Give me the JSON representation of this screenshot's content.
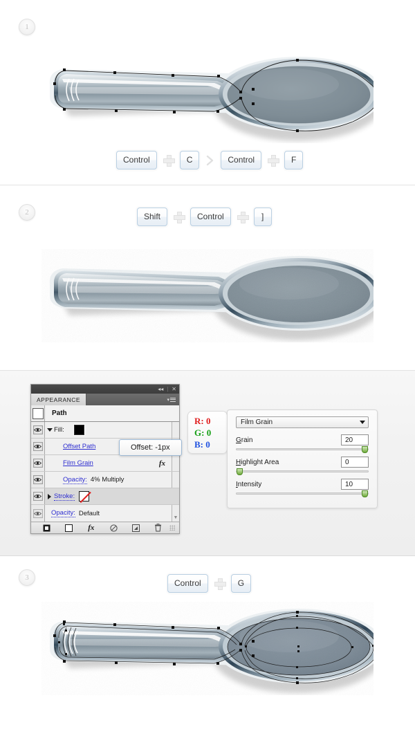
{
  "steps": [
    {
      "number": "1"
    },
    {
      "number": "2"
    },
    {
      "number": "3"
    }
  ],
  "shortcuts": [
    {
      "id": "shortcut-row-1",
      "items": [
        {
          "type": "key",
          "label": "Control"
        },
        {
          "type": "plus",
          "label": "+"
        },
        {
          "type": "key",
          "label": "C"
        },
        {
          "type": "chevron",
          "label": ">"
        },
        {
          "type": "key",
          "label": "Control"
        },
        {
          "type": "plus",
          "label": "+"
        },
        {
          "type": "key",
          "label": "F"
        }
      ]
    },
    {
      "id": "shortcut-row-2",
      "items": [
        {
          "type": "key",
          "label": "Shift"
        },
        {
          "type": "plus",
          "label": "+"
        },
        {
          "type": "key",
          "label": "Control"
        },
        {
          "type": "plus",
          "label": "+"
        },
        {
          "type": "key",
          "label": "]"
        }
      ]
    },
    {
      "id": "shortcut-row-3",
      "items": [
        {
          "type": "key",
          "label": "Control"
        },
        {
          "type": "plus",
          "label": "+"
        },
        {
          "type": "key",
          "label": "G"
        }
      ]
    }
  ],
  "appearance_panel": {
    "titlebar": {
      "collapse_icon": "◂◂",
      "separator": "|",
      "close_icon": "✕"
    },
    "tab_label": "APPEARANCE",
    "menu_icon": "panel-menu-icon",
    "object_row": {
      "label": "Path"
    },
    "rows": [
      {
        "name": "fill",
        "label": "Fill:",
        "kind": "fill",
        "swatch": "black",
        "expanded": true,
        "visible": true
      },
      {
        "name": "offset-path",
        "label": "Offset Path",
        "kind": "effect-link",
        "visible": true
      },
      {
        "name": "film-grain",
        "label": "Film Grain",
        "kind": "effect-link",
        "fx": "fx",
        "visible": true
      },
      {
        "name": "fill-opacity",
        "label": "Opacity:",
        "value": "4% Multiply",
        "kind": "opacity",
        "visible": true
      },
      {
        "name": "stroke",
        "label": "Stroke:",
        "kind": "stroke",
        "swatch": "none",
        "expanded": false,
        "visible": true,
        "selected": true
      },
      {
        "name": "object-opacity",
        "label": "Opacity:",
        "value": "Default",
        "kind": "opacity",
        "visible": true
      }
    ],
    "footer_buttons": [
      {
        "name": "add-new-stroke-button",
        "icon": "filled-square-icon"
      },
      {
        "name": "add-new-fill-button",
        "icon": "outlined-square-icon"
      },
      {
        "name": "add-new-effect-button",
        "icon": "fx-icon",
        "label": "fx"
      },
      {
        "name": "clear-appearance-button",
        "icon": "no-symbol-icon"
      },
      {
        "name": "duplicate-item-button",
        "icon": "duplicate-icon"
      },
      {
        "name": "delete-item-button",
        "icon": "trash-icon"
      }
    ],
    "scroll_up_icon": "▲",
    "scroll_down_icon": "▼"
  },
  "tooltip": {
    "text": "Offset: -1px"
  },
  "rgb_readout": {
    "r_label": "R:",
    "r_value": "0",
    "g_label": "G:",
    "g_value": "0",
    "b_label": "B:",
    "b_value": "0",
    "r_color": "#e02020",
    "g_color": "#17a017",
    "b_color": "#2052e0"
  },
  "film_grain_dialog": {
    "effect_name": "Film Grain",
    "sliders": [
      {
        "name": "grain",
        "label_pre": "G",
        "label_rest": "rain",
        "value": "20",
        "percent": 100
      },
      {
        "name": "highlight-area",
        "label_pre": "H",
        "label_rest": "ighlight Area",
        "value": "0",
        "percent": 0
      },
      {
        "name": "intensity",
        "label_pre": "I",
        "label_rest": "ntensity",
        "value": "10",
        "percent": 100
      }
    ]
  },
  "illustrations": [
    {
      "name": "spoon-step-1",
      "caption": "metallic spoon with path anchor points selected"
    },
    {
      "name": "spoon-step-2",
      "caption": "metallic spoon with film grain texture applied"
    },
    {
      "name": "spoon-step-3",
      "caption": "metallic spoon grouped with all paths selected"
    }
  ]
}
